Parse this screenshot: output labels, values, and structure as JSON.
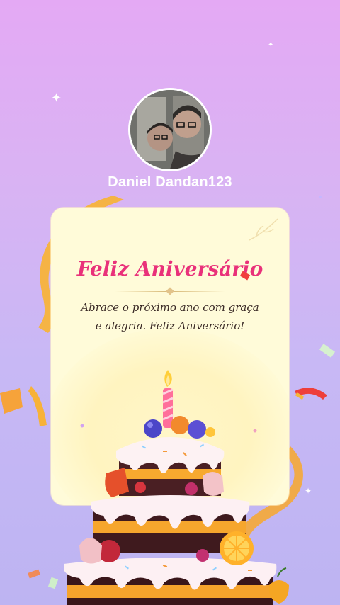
{
  "profile": {
    "username": "Daniel Dandan123"
  },
  "card": {
    "title": "Feliz Aniversário",
    "message": "Abrace o próximo ano com graça e alegria. Feliz Aniversário!"
  },
  "colors": {
    "title": "#e9317a",
    "card_background": "#fffbd9",
    "ribbon": "#f7b33a",
    "background_top": "#e4a9f4",
    "background_bottom": "#bdb4f2"
  },
  "icons": [
    "sparkle-icon",
    "confetti-icon",
    "ribbon-icon",
    "candle-icon",
    "birthday-cake-icon"
  ]
}
